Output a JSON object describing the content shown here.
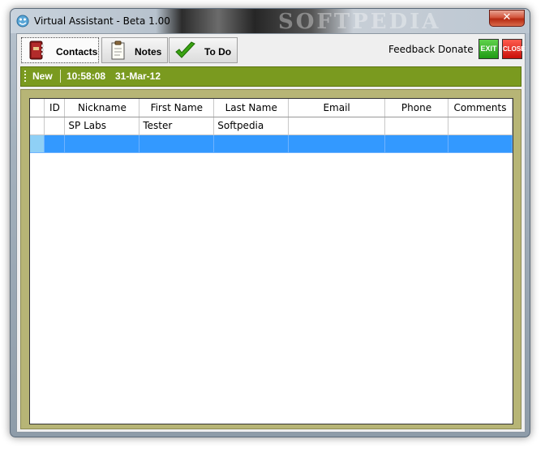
{
  "window": {
    "title": "Virtual Assistant - Beta 1.00",
    "watermark": "SOFTPEDIA"
  },
  "titlebar": {
    "close_glyph": "✕"
  },
  "tabs": [
    {
      "label": "Contacts",
      "icon": "address-book-icon",
      "active": true
    },
    {
      "label": "Notes",
      "icon": "notepad-icon",
      "active": false
    },
    {
      "label": "To Do",
      "icon": "checkmark-icon",
      "active": false
    }
  ],
  "toplinks": {
    "feedback": "Feedback",
    "donate": "Donate"
  },
  "buttons": {
    "exit": "EXIT",
    "close": "CLOSE"
  },
  "statusbar": {
    "new_label": "New",
    "time": "10:58:08",
    "date": "31-Mar-12"
  },
  "table": {
    "columns": [
      "ID",
      "Nickname",
      "First Name",
      "Last Name",
      "Email",
      "Phone",
      "Comments"
    ],
    "rows": [
      {
        "id": "",
        "nickname": "SP Labs",
        "first_name": "Tester",
        "last_name": "Softpedia",
        "email": "",
        "phone": "",
        "comments": ""
      }
    ]
  },
  "colors": {
    "green_bar": "#7a9a1f",
    "panel": "#b7b576",
    "selection": "#3399ff"
  }
}
